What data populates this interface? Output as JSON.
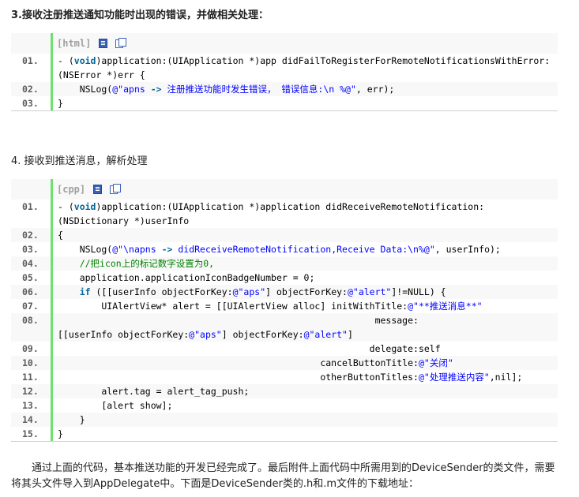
{
  "section3": {
    "heading": "3.接收注册推送通知功能时出现的错误，并做相关处理：",
    "lang_label": "[html]",
    "lines": [
      {
        "num": "01.",
        "text": "- (void)application:(UIApplication *)app didFailToRegisterForRemoteNotificationsWithError:"
      },
      {
        "num": "",
        "text": "(NSError *)err {"
      },
      {
        "num": "02.",
        "text": "    NSLog(@\"apns -> 注册推送功能时发生错误， 错误信息:\\n %@\", err);"
      },
      {
        "num": "03.",
        "text": "}"
      }
    ]
  },
  "section4": {
    "heading": "4. 接收到推送消息，解析处理",
    "lang_label": "[cpp]",
    "lines": [
      {
        "num": "01.",
        "text": "- (void)application:(UIApplication *)application didReceiveRemoteNotification:"
      },
      {
        "num": "",
        "text": "(NSDictionary *)userInfo"
      },
      {
        "num": "02.",
        "text": "{"
      },
      {
        "num": "03.",
        "text": "    NSLog(@\"\\napns -> didReceiveRemoteNotification,Receive Data:\\n%@\", userInfo);"
      },
      {
        "num": "04.",
        "text": "    //把icon上的标记数字设置为0,"
      },
      {
        "num": "05.",
        "text": "    application.applicationIconBadgeNumber = 0;"
      },
      {
        "num": "06.",
        "text": "    if ([[userInfo objectForKey:@\"aps\"] objectForKey:@\"alert\"]!=NULL) {"
      },
      {
        "num": "07.",
        "text": "        UIAlertView* alert = [[UIAlertView alloc] initWithTitle:@\"**推送消息**\""
      },
      {
        "num": "08.",
        "text": "                                                          message:"
      },
      {
        "num": "",
        "text": "[[userInfo objectForKey:@\"aps\"] objectForKey:@\"alert\"]"
      },
      {
        "num": "09.",
        "text": "                                                         delegate:self"
      },
      {
        "num": "10.",
        "text": "                                                cancelButtonTitle:@\"关闭\""
      },
      {
        "num": "11.",
        "text": "                                                otherButtonTitles:@\"处理推送内容\",nil];"
      },
      {
        "num": "12.",
        "text": "        alert.tag = alert_tag_push;"
      },
      {
        "num": "13.",
        "text": "        [alert show];"
      },
      {
        "num": "14.",
        "text": "    }"
      },
      {
        "num": "15.",
        "text": "}"
      }
    ]
  },
  "footer_paragraph": "通过上面的代码，基本推送功能的开发已经完成了。最后附件上面代码中所需用到的DeviceSender的类文件，需要将其头文件导入到AppDelegate中。下面是DeviceSender类的.h和.m文件的下载地址：",
  "colors": {
    "gutter_bar": "#6ce26c",
    "keyword": "#006699",
    "string": "#0000ff",
    "comment": "#008200"
  }
}
